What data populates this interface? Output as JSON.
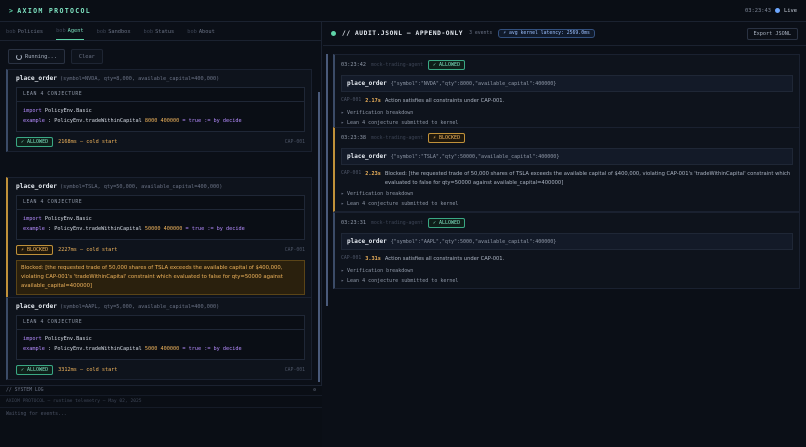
{
  "app": {
    "brand_prefix": ">",
    "brand": "AXIOM PROTOCOL",
    "clock": "03:23:43",
    "live_label": "Live"
  },
  "tabs": [
    {
      "prefix": "bob",
      "label": "Policies",
      "active": false
    },
    {
      "prefix": "bob",
      "label": "Agent",
      "active": true
    },
    {
      "prefix": "bob",
      "label": "Sandbox",
      "active": false
    },
    {
      "prefix": "bob",
      "label": "Status",
      "active": false
    },
    {
      "prefix": "bob",
      "label": "About",
      "active": false
    }
  ],
  "controls": {
    "running_label": "Running...",
    "clear_label": "Clear"
  },
  "lean_heading": "LEAN 4 CONJECTURE",
  "lean_import_kw": "import",
  "lean_import_mod": "PolicyEnv.Basic",
  "lean_example_kw": "example",
  "lean_decide": "= true := by decide",
  "cards": [
    {
      "fn": "place_order",
      "args": "(symbol=NVDA, qty=8,000, available_capital=400,000)",
      "expr": ": PolicyEnv.tradeWithinCapital",
      "n1": "8000",
      "n2": "400000",
      "status": "✓ ALLOWED",
      "latency": "2168ms — cold start",
      "cap": "CAP-001"
    },
    {
      "fn": "place_order",
      "args": "(symbol=TSLA, qty=50,000, available_capital=400,000)",
      "expr": ": PolicyEnv.tradeWithinCapital",
      "n1": "50000",
      "n2": "400000",
      "status": "⚡ BLOCKED",
      "latency": "2227ms — cold start",
      "cap": "CAP-001",
      "reason": "Blocked: [the requested trade of 50,000 shares of TSLA exceeds the available capital of $400,000, violating CAP-001's 'tradeWithinCapital' constraint which evaluated to false for qty=50000 against available_capital=400000]"
    },
    {
      "fn": "place_order",
      "args": "(symbol=AAPL, qty=5,000, available_capital=400,000)",
      "expr": ": PolicyEnv.tradeWithinCapital",
      "n1": "5000",
      "n2": "400000",
      "status": "✓ ALLOWED",
      "latency": "3312ms — cold start",
      "cap": "CAP-001"
    }
  ],
  "syslog": {
    "title": "// SYSTEM LOG",
    "collapse": "⊖",
    "sub": "AXIOM PROTOCOL — runtime telemetry — May 02, 2025",
    "message": "Waiting for events..."
  },
  "audit": {
    "title": "// AUDIT.JSONL — APPEND-ONLY",
    "count": "3 events",
    "latency_pill": "⚡ avg kernel latency: 2569.0ms",
    "export_label": "Export JSONL",
    "breakdown_label": "Verification breakdown",
    "lean_label": "Lean 4 conjecture submitted to kernel",
    "entries": [
      {
        "time": "03:23:42",
        "agent": "mock-trading-agent",
        "status": "✓ ALLOWED",
        "fn": "place_order",
        "args": "{\"symbol\":\"NVDA\",\"qty\":8000,\"available_capital\":400000}",
        "cap": "CAP-001",
        "latency": "2.17s",
        "reason": "Action satisfies all constraints under CAP-001."
      },
      {
        "time": "03:23:38",
        "agent": "mock-trading-agent",
        "status": "⚡ BLOCKED",
        "fn": "place_order",
        "args": "{\"symbol\":\"TSLA\",\"qty\":50000,\"available_capital\":400000}",
        "cap": "CAP-001",
        "latency": "2.23s",
        "reason": "Blocked: [the requested trade of 50,000 shares of TSLA exceeds the available capital of $400,000, violating CAP-001's 'tradeWithinCapital' constraint which evaluated to false for qty=50000 against available_capital=400000]"
      },
      {
        "time": "03:23:31",
        "agent": "mock-trading-agent",
        "status": "✓ ALLOWED",
        "fn": "place_order",
        "args": "{\"symbol\":\"AAPL\",\"qty\":5000,\"available_capital\":400000}",
        "cap": "CAP-001",
        "latency": "3.31s",
        "reason": "Action satisfies all constraints under CAP-001."
      }
    ]
  },
  "colors": {
    "accent": "#5fd3a8",
    "allowed": "#7ee3c1",
    "blocked": "#f0b45c",
    "link": "#6ea8ff"
  }
}
